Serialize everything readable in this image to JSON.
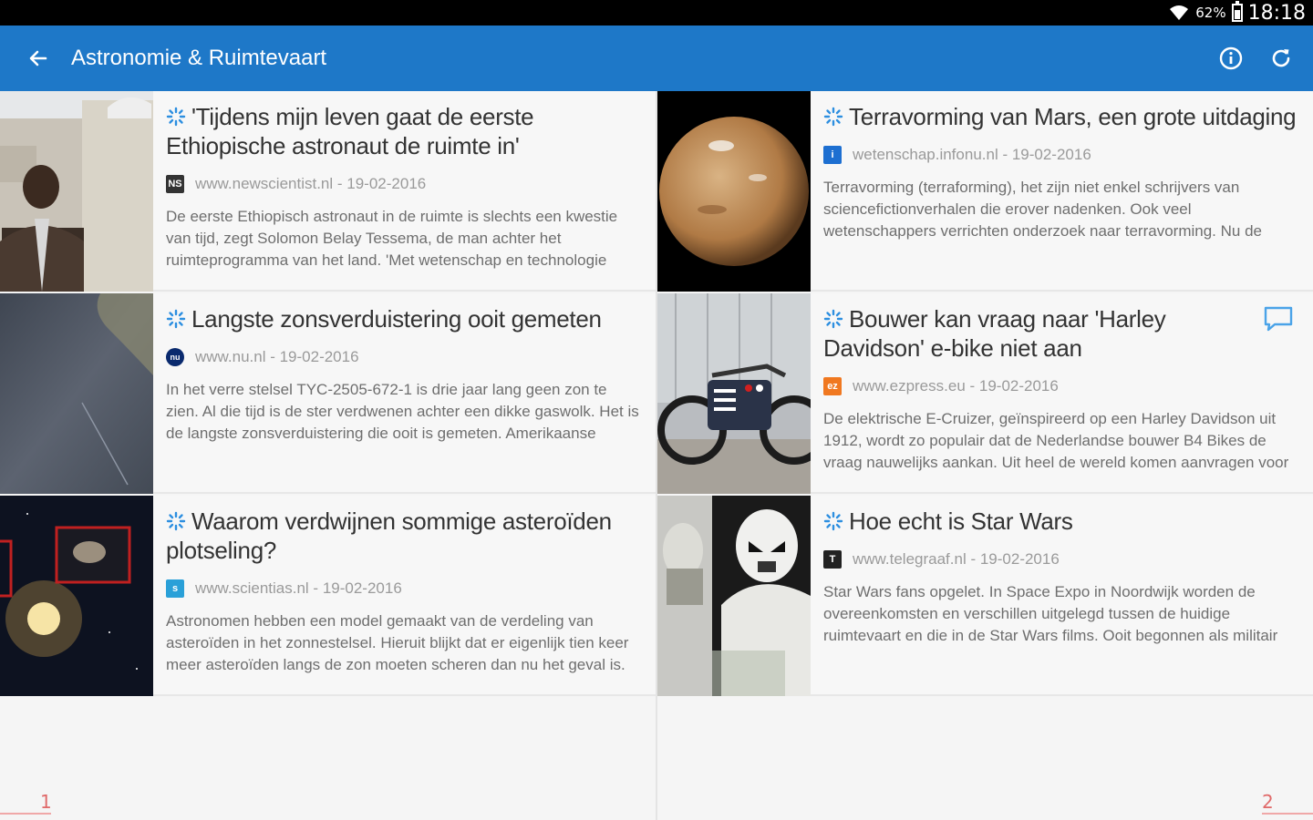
{
  "status_bar": {
    "battery": "62%",
    "time": "18:18"
  },
  "app_bar": {
    "title": "Astronomie & Ruimtevaart",
    "back_icon": "arrow-left-icon",
    "info_icon": "info-icon",
    "refresh_icon": "refresh-icon",
    "color": "#1e78c8"
  },
  "left_column": {
    "page_number": "1",
    "articles": [
      {
        "headline": "'Tijdens mijn leven gaat de eerste Ethiopische astronaut de ruimte in'",
        "source": "www.newscientist.nl - 19-02-2016",
        "snippet": "De eerste Ethiopisch astronaut in de ruimte is slechts een kwestie van tijd, zegt Solomon Belay Tessema, de man achter het ruimteprogramma van het land. 'Met wetenschap en technologie kunnen we de armoede...",
        "source_icon": "NS"
      },
      {
        "headline": "Langste zonsverduistering ooit gemeten",
        "source": "www.nu.nl - 19-02-2016",
        "snippet": "In het verre stelsel TYC-2505-672-1 is drie jaar lang geen zon te zien. Al die tijd is de ster verdwenen achter een dikke gaswolk. Het is de langste zonsverduistering die ooit is gemeten. Amerikaanse sterrenkundigen...",
        "source_icon": "nu"
      },
      {
        "headline": "Waarom verdwijnen sommige asteroïden plotseling?",
        "source": "www.scientias.nl - 19-02-2016",
        "snippet": "Astronomen hebben een model gemaakt van de verdeling van asteroïden in het zonnestelsel. Hieruit blijkt dat er eigenlijk tien keer meer asteroïden langs de zon moeten scheren dan nu het geval is. Wa...",
        "source_icon": "s"
      }
    ]
  },
  "right_column": {
    "page_number": "2",
    "articles": [
      {
        "headline": "Terravorming van Mars, een grote uitdaging",
        "source": "wetenschap.infonu.nl - 19-02-2016",
        "snippet": "Terravorming (terraforming), het zijn niet enkel schrijvers van sciencefictionverhalen die erover nadenken. Ook veel wetenschappers verrichten onderzoek naar terravorming. Nu de mens in staat is om me...",
        "source_icon": "i"
      },
      {
        "headline": "Bouwer kan vraag naar 'Harley Davidson' e-bike niet aan",
        "source": "www.ezpress.eu - 19-02-2016",
        "snippet": "De elektrische E-Cruizer, geïnspireerd op een Harley Davidson uit 1912, wordt zo populair dat de Nederlandse bouwer B4 Bikes de vraag nauwelijks aankan. Uit heel de wereld komen aanvragen voor de op...",
        "source_icon": "ez",
        "has_comments": true
      },
      {
        "headline": "Hoe echt is Star Wars",
        "source": "www.telegraaf.nl - 19-02-2016",
        "snippet": "Star Wars fans opgelet. In Space Expo in Noordwijk worden de overeenkomsten en verschillen uitgelegd tussen de huidige ruimtevaart en die in de Star Wars films. Ooit begonnen als militair wapensysteem, ...",
        "source_icon": "T"
      }
    ]
  }
}
